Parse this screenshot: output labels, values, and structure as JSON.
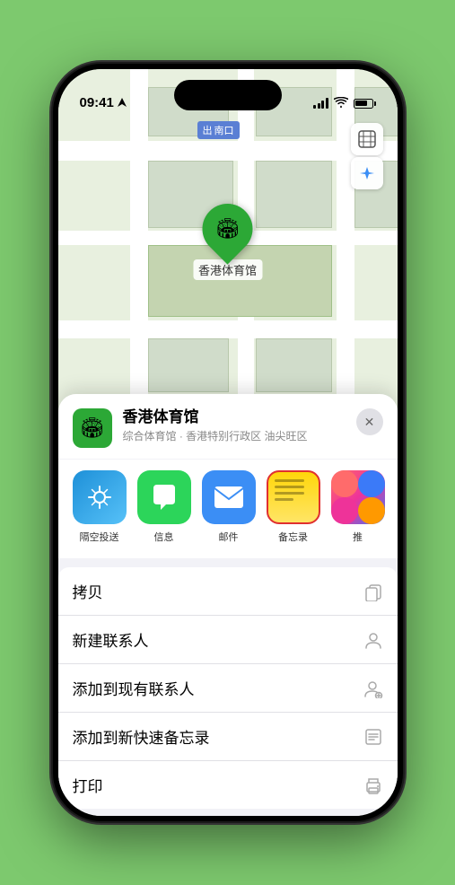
{
  "status_bar": {
    "time": "09:41",
    "location_arrow": "▶"
  },
  "map": {
    "label": "南口",
    "label_prefix": "出"
  },
  "controls": {
    "map_btn": "🗺",
    "location_btn": "➤"
  },
  "stadium": {
    "name": "香港体育馆",
    "emoji": "🏟",
    "pin_dot": "•"
  },
  "place_header": {
    "icon_emoji": "🏟",
    "name": "香港体育馆",
    "description": "综合体育馆 · 香港特别行政区 油尖旺区",
    "close": "✕"
  },
  "share_items": [
    {
      "label": "隔空投送",
      "type": "airdrop"
    },
    {
      "label": "信息",
      "type": "messages"
    },
    {
      "label": "邮件",
      "type": "mail"
    },
    {
      "label": "备忘录",
      "type": "notes"
    },
    {
      "label": "推",
      "type": "more"
    }
  ],
  "actions": [
    {
      "label": "拷贝",
      "icon": "📋"
    },
    {
      "label": "新建联系人",
      "icon": "👤"
    },
    {
      "label": "添加到现有联系人",
      "icon": "👤"
    },
    {
      "label": "添加到新快速备忘录",
      "icon": "📝"
    },
    {
      "label": "打印",
      "icon": "🖨"
    }
  ],
  "colors": {
    "green_accent": "#2ca836",
    "notes_border": "#e03030",
    "notes_bg_top": "#ffd60a",
    "notes_bg_bottom": "#ffe566"
  }
}
